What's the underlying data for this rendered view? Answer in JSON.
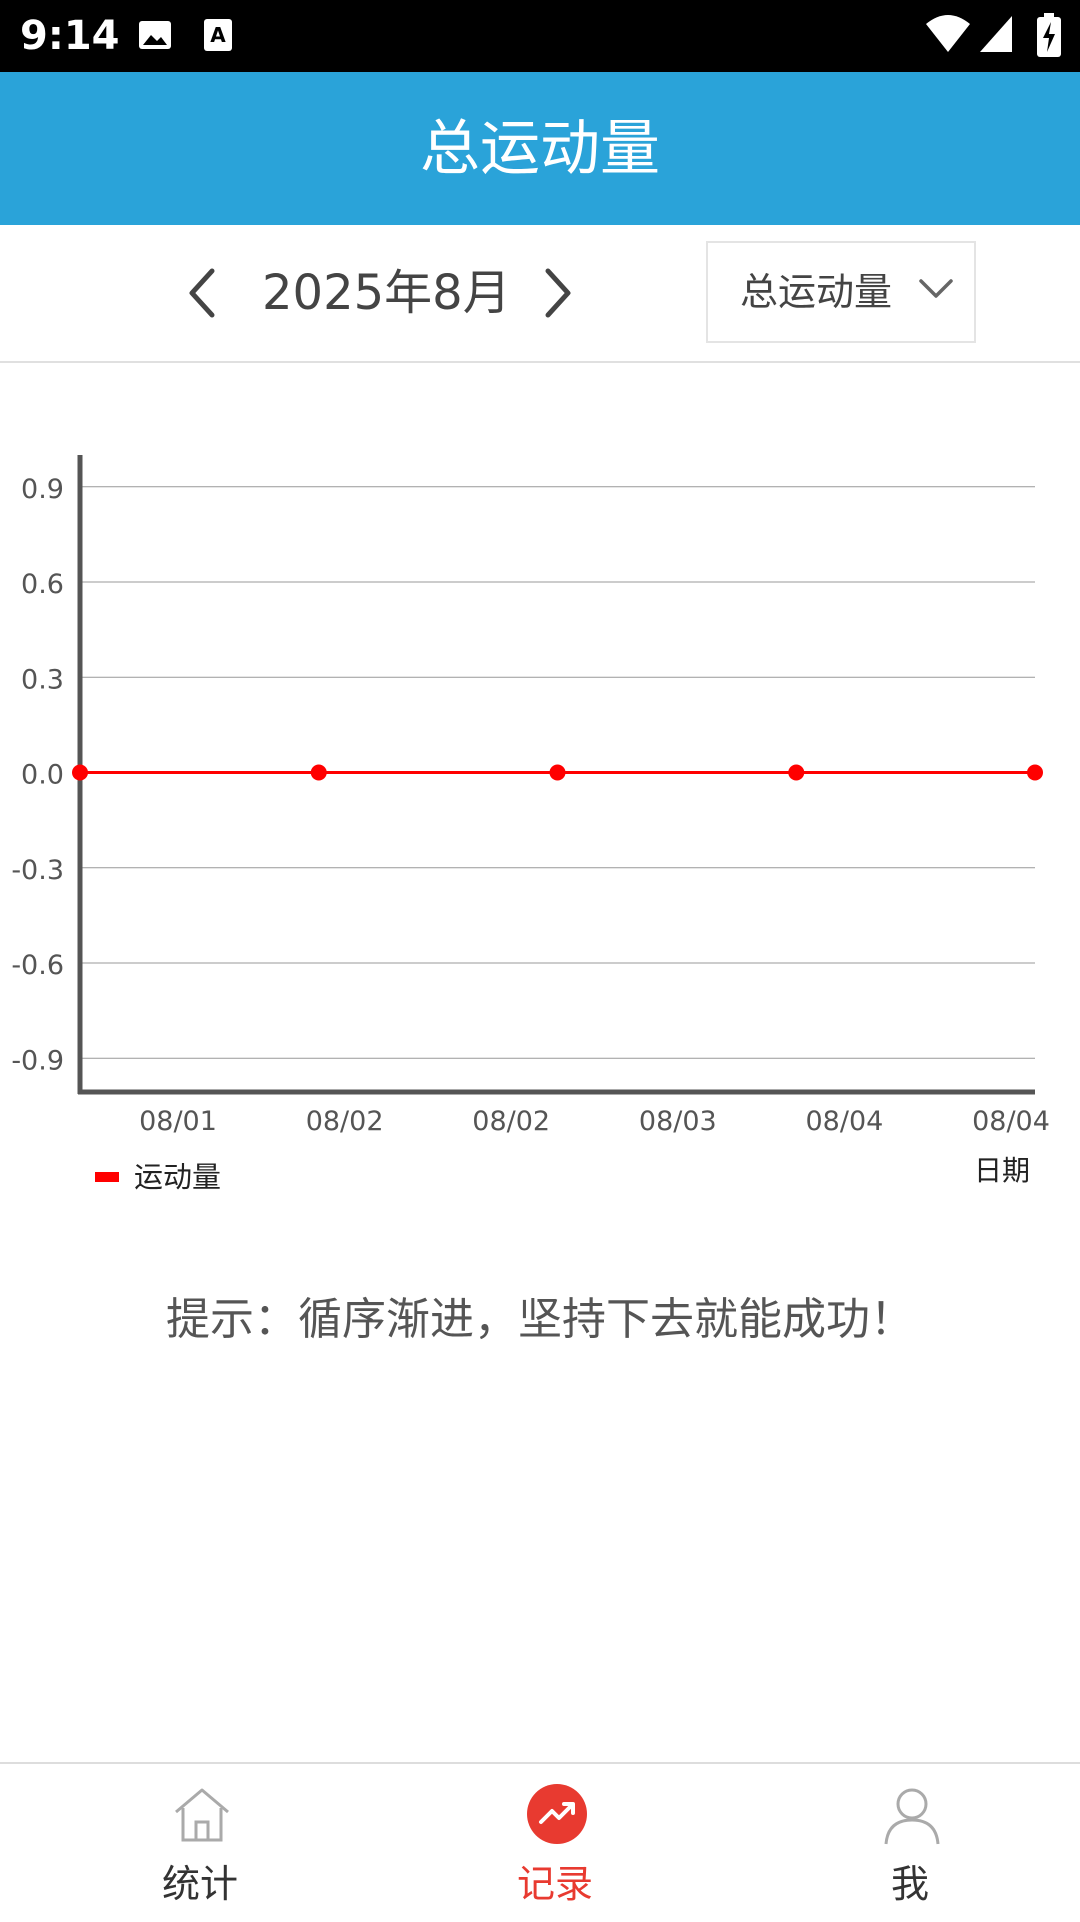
{
  "status_bar": {
    "time": "9:14",
    "icons": [
      "image-notification-icon",
      "a-text-notification-icon",
      "wifi-icon",
      "signal-icon",
      "battery-charging-icon"
    ]
  },
  "header": {
    "title": "总运动量"
  },
  "toolbar": {
    "month": "2025年8月",
    "metric": "总运动量",
    "prev_icon": "chevron-left-icon",
    "next_icon": "chevron-right-icon",
    "dropdown_icon": "chevron-down-icon"
  },
  "chart_data": {
    "type": "line",
    "x": [
      "08/01",
      "08/02",
      "08/02",
      "08/03",
      "08/04",
      "08/04"
    ],
    "xlabel": "日期",
    "ylabel": "",
    "y_ticks": [
      "0.9",
      "0.6",
      "0.3",
      "0.0",
      "-0.3",
      "-0.6",
      "-0.9"
    ],
    "ylim": [
      -1.0,
      1.0
    ],
    "grid": true,
    "legend_position": "bottom-left",
    "series": [
      {
        "name": "运动量",
        "color": "#ff0000",
        "x": [
          "08/01",
          "08/02",
          "08/03",
          "08/04",
          "08/04"
        ],
        "values": [
          0,
          0,
          0,
          0,
          0
        ]
      }
    ]
  },
  "hint": "提示：循序渐进，坚持下去就能成功！",
  "bottom_nav": {
    "items": [
      {
        "label": "统计",
        "icon": "home-icon",
        "active": false
      },
      {
        "label": "记录",
        "icon": "trend-up-icon",
        "active": true
      },
      {
        "label": "我",
        "icon": "user-icon",
        "active": false
      }
    ],
    "active_color": "#e83a30"
  }
}
